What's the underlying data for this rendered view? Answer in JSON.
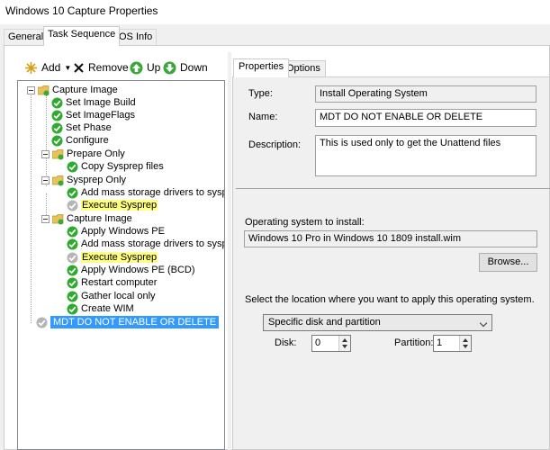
{
  "window": {
    "title": "Windows 10 Capture Properties"
  },
  "tabs": [
    "General",
    "Task Sequence",
    "OS Info"
  ],
  "toolbar": {
    "add": "Add",
    "remove": "Remove",
    "up": "Up",
    "down": "Down"
  },
  "tree": {
    "root": "Capture Image",
    "set_image_build": "Set Image Build",
    "set_image_flags": "Set ImageFlags",
    "set_phase": "Set Phase",
    "configure": "Configure",
    "prepare_only": "Prepare Only",
    "copy_sysprep": "Copy Sysprep files",
    "sysprep_only": "Sysprep Only",
    "add_mass_storage_1": "Add mass storage drivers to sysprep.ir",
    "execute_sysprep_1": "Execute Sysprep",
    "capture_image_group": "Capture Image",
    "apply_winpe": "Apply Windows PE",
    "add_mass_storage_2": "Add mass storage drivers to sysprep.ir",
    "execute_sysprep_2": "Execute Sysprep",
    "apply_winpe_bcd": "Apply Windows PE (BCD)",
    "restart_computer": "Restart computer",
    "gather_local": "Gather local only",
    "create_wim": "Create WIM",
    "mdt_step": "MDT DO NOT ENABLE OR DELETE"
  },
  "right_tabs": [
    "Properties",
    "Options"
  ],
  "properties": {
    "type_label": "Type:",
    "type_value": "Install Operating System",
    "name_label": "Name:",
    "name_value": "MDT DO NOT ENABLE OR DELETE",
    "description_label": "Description:",
    "description_value": "This is used only to get the Unattend files",
    "os_label": "Operating system to install:",
    "os_value": "Windows 10 Pro in Windows 10 1809 install.wim",
    "browse": "Browse...",
    "location_label": "Select the location where you want to apply this operating system.",
    "location_value": "Specific disk and partition",
    "disk_label": "Disk:",
    "disk_value": "0",
    "partition_label": "Partition:",
    "partition_value": "1"
  },
  "colors": {
    "selection": "#3399ff",
    "highlight": "#ffff80",
    "success": "#2eaa2e"
  }
}
